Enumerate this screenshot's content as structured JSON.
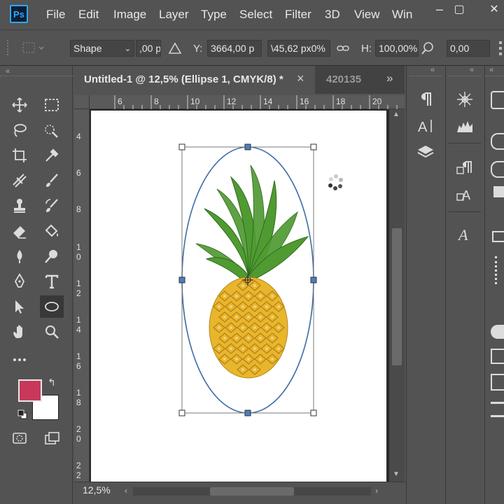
{
  "app": {
    "logo_text": "Ps"
  },
  "menu": {
    "items": [
      "File",
      "Edit",
      "Image",
      "Layer",
      "Type",
      "Select",
      "Filter",
      "3D",
      "View",
      "Win"
    ]
  },
  "window_controls": {
    "minimize": "–",
    "restore": "▢",
    "close": "✕"
  },
  "options_bar": {
    "mode": "Shape",
    "w_value": ",00 p",
    "y_label": "Y:",
    "y_value": "3664,00 p",
    "angle_value": "\\45,62 px0%",
    "h_label": "H:",
    "h_value": "100,00%",
    "corner_value": "0,00"
  },
  "document": {
    "active_tab": "Untitled-1 @ 12,5% (Ellipse 1, CMYK/8) *",
    "inactive_tab": "420135",
    "tab_close": "×",
    "overflow": "»",
    "zoom": "12,5%"
  },
  "ruler": {
    "top": [
      "6",
      "8",
      "10",
      "12",
      "14",
      "16",
      "18",
      "20"
    ],
    "left": [
      [
        "4"
      ],
      [
        "6"
      ],
      [
        "8"
      ],
      [
        "1",
        "0"
      ],
      [
        "1",
        "2"
      ],
      [
        "1",
        "4"
      ],
      [
        "1",
        "6"
      ],
      [
        "1",
        "8"
      ],
      [
        "2",
        "0"
      ],
      [
        "2",
        "2"
      ]
    ]
  },
  "colors": {
    "foreground": "#c8385a",
    "background": "#ffffff",
    "path": "#3a6fa6",
    "handle": "#4a7fbf",
    "pineapple_leaf": "#4f9b32",
    "pineapple_body": "#e8b62c"
  },
  "tools": [
    [
      "move-tool-icon",
      "marquee-tool-icon"
    ],
    [
      "lasso-tool-icon",
      "quick-select-tool-icon"
    ],
    [
      "crop-tool-icon",
      "eyedropper-tool-icon"
    ],
    [
      "healing-tool-icon",
      "brush-tool-icon"
    ],
    [
      "stamp-tool-icon",
      "history-brush-tool-icon"
    ],
    [
      "eraser-tool-icon",
      "paint-bucket-tool-icon"
    ],
    [
      "blur-tool-icon",
      "dodge-tool-icon"
    ],
    [
      "pen-tool-icon",
      "type-tool-icon"
    ],
    [
      "path-select-tool-icon",
      "ellipse-tool-icon"
    ],
    [
      "hand-tool-icon",
      "zoom-tool-icon"
    ]
  ],
  "panel_icons": {
    "strip1": [
      "paragraph-icon",
      "character-icon",
      "layers-icon"
    ],
    "strip2": [
      "brushes-icon",
      "levels-icon",
      "paragraph-styles-icon",
      "character-styles-icon",
      "glyphs-icon"
    ]
  }
}
